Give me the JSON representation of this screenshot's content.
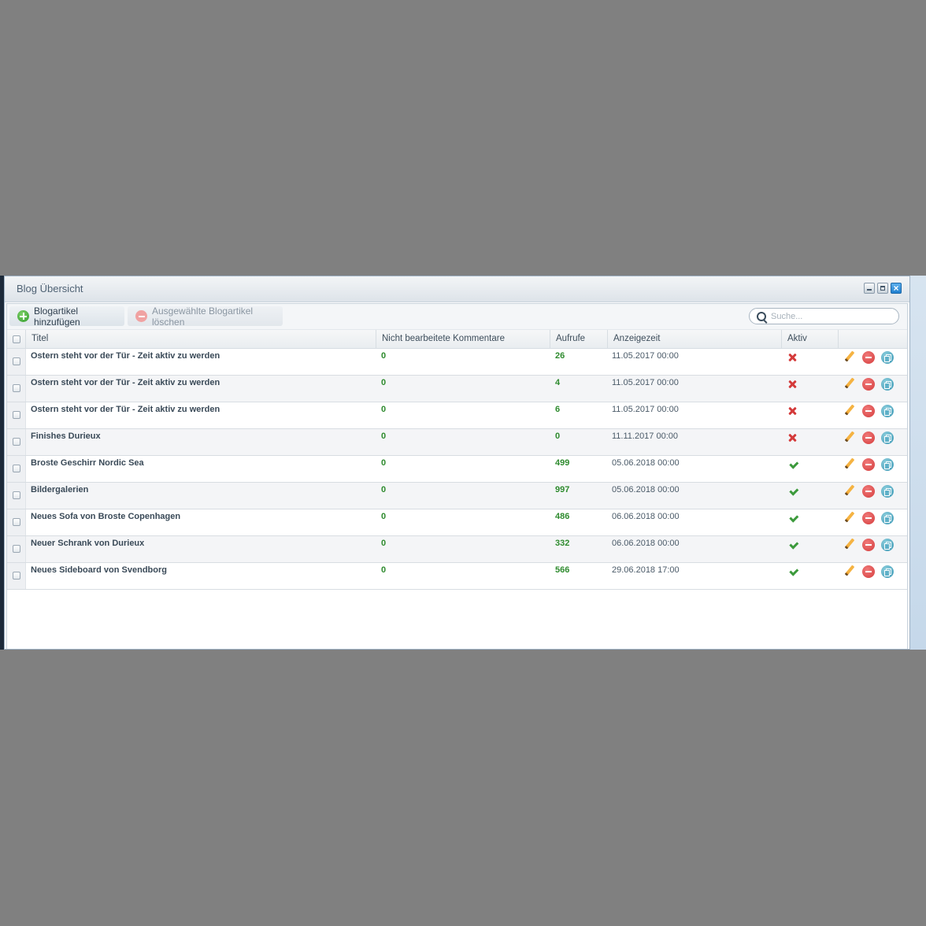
{
  "window": {
    "title": "Blog Übersicht"
  },
  "toolbar": {
    "add_label": "Blogartikel hinzufügen",
    "delete_label": "Ausgewählte Blogartikel löschen",
    "search_placeholder": "Suche..."
  },
  "columns": {
    "title": "Titel",
    "comments": "Nicht bearbeitete Kommentare",
    "views": "Aufrufe",
    "display_time": "Anzeigezeit",
    "active": "Aktiv"
  },
  "rows": [
    {
      "title": "Ostern steht vor der Tür - Zeit aktiv zu werden",
      "comments": "0",
      "views": "26",
      "time": "11.05.2017 00:00",
      "active": false
    },
    {
      "title": "Ostern steht vor der Tür - Zeit aktiv zu werden",
      "comments": "0",
      "views": "4",
      "time": "11.05.2017 00:00",
      "active": false
    },
    {
      "title": "Ostern steht vor der Tür - Zeit aktiv zu werden",
      "comments": "0",
      "views": "6",
      "time": "11.05.2017 00:00",
      "active": false
    },
    {
      "title": "Finishes Durieux",
      "comments": "0",
      "views": "0",
      "time": "11.11.2017 00:00",
      "active": false
    },
    {
      "title": "Broste Geschirr Nordic Sea",
      "comments": "0",
      "views": "499",
      "time": "05.06.2018 00:00",
      "active": true
    },
    {
      "title": "Bildergalerien",
      "comments": "0",
      "views": "997",
      "time": "05.06.2018 00:00",
      "active": true
    },
    {
      "title": "Neues Sofa von Broste Copenhagen",
      "comments": "0",
      "views": "486",
      "time": "06.06.2018 00:00",
      "active": true
    },
    {
      "title": "Neuer Schrank von Durieux",
      "comments": "0",
      "views": "332",
      "time": "06.06.2018 00:00",
      "active": true
    },
    {
      "title": "Neues Sideboard von Svendborg",
      "comments": "0",
      "views": "566",
      "time": "29.06.2018 17:00",
      "active": true
    }
  ],
  "colors": {
    "accent_green": "#2e8b2e",
    "inactive_red": "#d43a3a",
    "window_close_blue": "#1f7fcf"
  }
}
